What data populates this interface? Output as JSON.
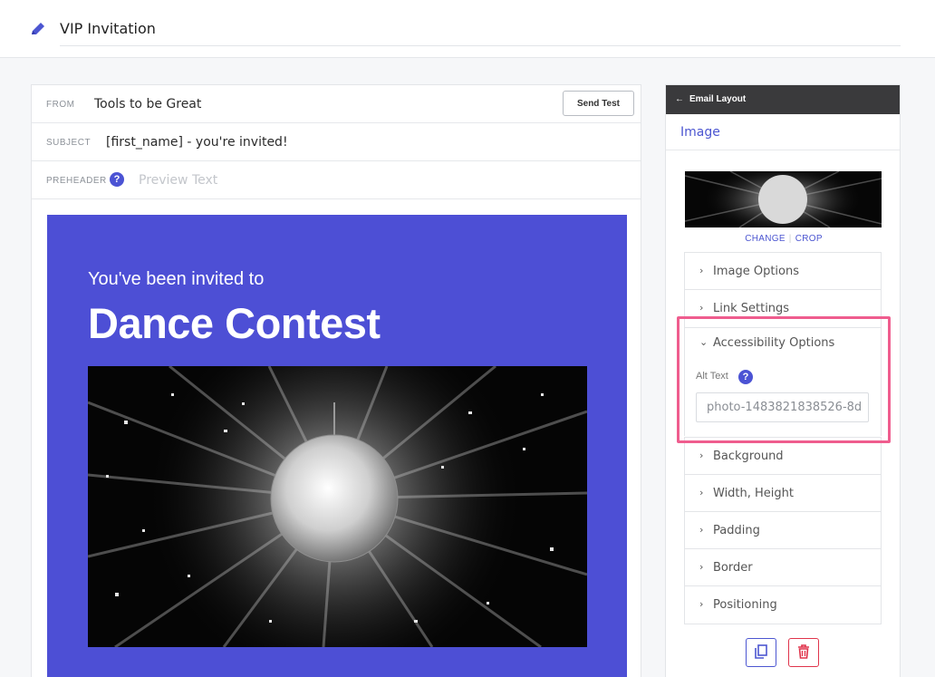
{
  "header": {
    "title": "VIP Invitation"
  },
  "email": {
    "from_label": "FROM",
    "from_value": "Tools to be Great",
    "send_test_label": "Send Test",
    "subject_label": "SUBJECT",
    "subject_value": "[first_name] - you're invited!",
    "preheader_label": "PREHEADER",
    "preheader_help": "?",
    "preheader_placeholder": "Preview Text"
  },
  "canvas": {
    "kicker": "You've been invited to",
    "headline": "Dance Contest",
    "background_color": "#4d4fd5"
  },
  "panel": {
    "back_label": "Email Layout",
    "element_type": "Image",
    "change_label": "CHANGE",
    "crop_label": "CROP",
    "sections": {
      "image_options": "Image Options",
      "link_settings": "Link Settings",
      "accessibility_options": "Accessibility Options",
      "background": "Background",
      "width_height": "Width, Height",
      "padding": "Padding",
      "border": "Border",
      "positioning": "Positioning"
    },
    "alt_text_label": "Alt Text",
    "alt_text_help": "?",
    "alt_text_value": "photo-1483821838526-8d"
  },
  "colors": {
    "accent": "#4c56d1",
    "danger": "#e0344b",
    "highlight": "#ef5d8e",
    "panel_header": "#3a3a3c"
  },
  "icons": [
    "pencil-icon",
    "help-icon",
    "chevron-right-icon",
    "chevron-down-icon",
    "copy-icon",
    "trash-icon",
    "back-arrow-icon"
  ]
}
